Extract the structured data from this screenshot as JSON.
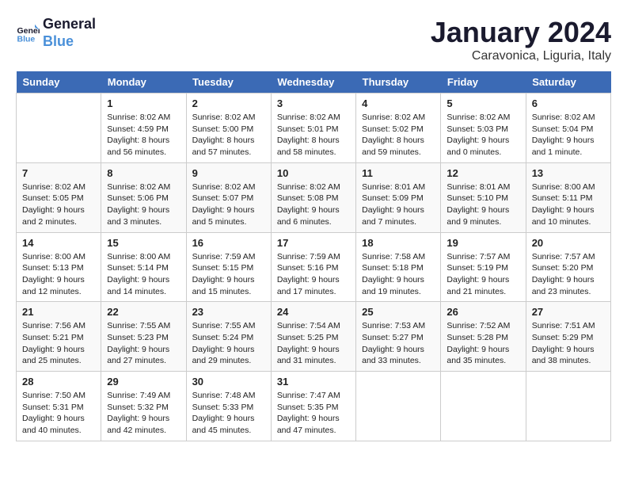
{
  "header": {
    "logo_line1": "General",
    "logo_line2": "Blue",
    "month": "January 2024",
    "location": "Caravonica, Liguria, Italy"
  },
  "weekdays": [
    "Sunday",
    "Monday",
    "Tuesday",
    "Wednesday",
    "Thursday",
    "Friday",
    "Saturday"
  ],
  "weeks": [
    [
      {
        "day": "",
        "info": ""
      },
      {
        "day": "1",
        "info": "Sunrise: 8:02 AM\nSunset: 4:59 PM\nDaylight: 8 hours\nand 56 minutes."
      },
      {
        "day": "2",
        "info": "Sunrise: 8:02 AM\nSunset: 5:00 PM\nDaylight: 8 hours\nand 57 minutes."
      },
      {
        "day": "3",
        "info": "Sunrise: 8:02 AM\nSunset: 5:01 PM\nDaylight: 8 hours\nand 58 minutes."
      },
      {
        "day": "4",
        "info": "Sunrise: 8:02 AM\nSunset: 5:02 PM\nDaylight: 8 hours\nand 59 minutes."
      },
      {
        "day": "5",
        "info": "Sunrise: 8:02 AM\nSunset: 5:03 PM\nDaylight: 9 hours\nand 0 minutes."
      },
      {
        "day": "6",
        "info": "Sunrise: 8:02 AM\nSunset: 5:04 PM\nDaylight: 9 hours\nand 1 minute."
      }
    ],
    [
      {
        "day": "7",
        "info": "Sunrise: 8:02 AM\nSunset: 5:05 PM\nDaylight: 9 hours\nand 2 minutes."
      },
      {
        "day": "8",
        "info": "Sunrise: 8:02 AM\nSunset: 5:06 PM\nDaylight: 9 hours\nand 3 minutes."
      },
      {
        "day": "9",
        "info": "Sunrise: 8:02 AM\nSunset: 5:07 PM\nDaylight: 9 hours\nand 5 minutes."
      },
      {
        "day": "10",
        "info": "Sunrise: 8:02 AM\nSunset: 5:08 PM\nDaylight: 9 hours\nand 6 minutes."
      },
      {
        "day": "11",
        "info": "Sunrise: 8:01 AM\nSunset: 5:09 PM\nDaylight: 9 hours\nand 7 minutes."
      },
      {
        "day": "12",
        "info": "Sunrise: 8:01 AM\nSunset: 5:10 PM\nDaylight: 9 hours\nand 9 minutes."
      },
      {
        "day": "13",
        "info": "Sunrise: 8:00 AM\nSunset: 5:11 PM\nDaylight: 9 hours\nand 10 minutes."
      }
    ],
    [
      {
        "day": "14",
        "info": "Sunrise: 8:00 AM\nSunset: 5:13 PM\nDaylight: 9 hours\nand 12 minutes."
      },
      {
        "day": "15",
        "info": "Sunrise: 8:00 AM\nSunset: 5:14 PM\nDaylight: 9 hours\nand 14 minutes."
      },
      {
        "day": "16",
        "info": "Sunrise: 7:59 AM\nSunset: 5:15 PM\nDaylight: 9 hours\nand 15 minutes."
      },
      {
        "day": "17",
        "info": "Sunrise: 7:59 AM\nSunset: 5:16 PM\nDaylight: 9 hours\nand 17 minutes."
      },
      {
        "day": "18",
        "info": "Sunrise: 7:58 AM\nSunset: 5:18 PM\nDaylight: 9 hours\nand 19 minutes."
      },
      {
        "day": "19",
        "info": "Sunrise: 7:57 AM\nSunset: 5:19 PM\nDaylight: 9 hours\nand 21 minutes."
      },
      {
        "day": "20",
        "info": "Sunrise: 7:57 AM\nSunset: 5:20 PM\nDaylight: 9 hours\nand 23 minutes."
      }
    ],
    [
      {
        "day": "21",
        "info": "Sunrise: 7:56 AM\nSunset: 5:21 PM\nDaylight: 9 hours\nand 25 minutes."
      },
      {
        "day": "22",
        "info": "Sunrise: 7:55 AM\nSunset: 5:23 PM\nDaylight: 9 hours\nand 27 minutes."
      },
      {
        "day": "23",
        "info": "Sunrise: 7:55 AM\nSunset: 5:24 PM\nDaylight: 9 hours\nand 29 minutes."
      },
      {
        "day": "24",
        "info": "Sunrise: 7:54 AM\nSunset: 5:25 PM\nDaylight: 9 hours\nand 31 minutes."
      },
      {
        "day": "25",
        "info": "Sunrise: 7:53 AM\nSunset: 5:27 PM\nDaylight: 9 hours\nand 33 minutes."
      },
      {
        "day": "26",
        "info": "Sunrise: 7:52 AM\nSunset: 5:28 PM\nDaylight: 9 hours\nand 35 minutes."
      },
      {
        "day": "27",
        "info": "Sunrise: 7:51 AM\nSunset: 5:29 PM\nDaylight: 9 hours\nand 38 minutes."
      }
    ],
    [
      {
        "day": "28",
        "info": "Sunrise: 7:50 AM\nSunset: 5:31 PM\nDaylight: 9 hours\nand 40 minutes."
      },
      {
        "day": "29",
        "info": "Sunrise: 7:49 AM\nSunset: 5:32 PM\nDaylight: 9 hours\nand 42 minutes."
      },
      {
        "day": "30",
        "info": "Sunrise: 7:48 AM\nSunset: 5:33 PM\nDaylight: 9 hours\nand 45 minutes."
      },
      {
        "day": "31",
        "info": "Sunrise: 7:47 AM\nSunset: 5:35 PM\nDaylight: 9 hours\nand 47 minutes."
      },
      {
        "day": "",
        "info": ""
      },
      {
        "day": "",
        "info": ""
      },
      {
        "day": "",
        "info": ""
      }
    ]
  ]
}
